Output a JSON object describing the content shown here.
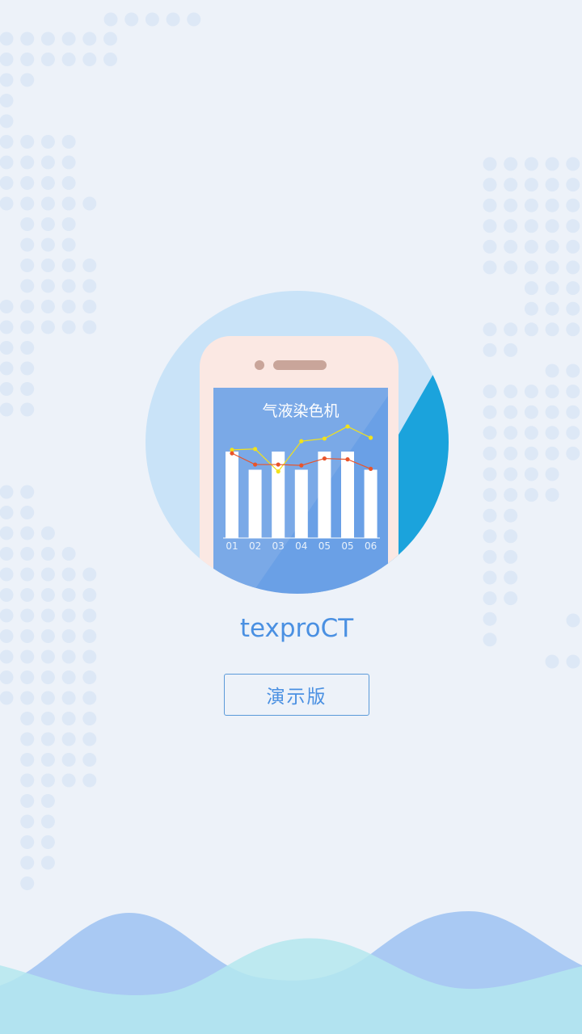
{
  "app": {
    "name": "texproCT",
    "demo_button_label": "演示版"
  },
  "logo": {
    "chart_title": "气液染色机"
  },
  "chart_data": {
    "type": "bar",
    "title": "气液染色机",
    "categories": [
      "01",
      "02",
      "03",
      "04",
      "05",
      "05",
      "06"
    ],
    "bars": [
      1.0,
      0.79,
      1.0,
      0.79,
      1.0,
      1.0,
      0.79
    ],
    "lines": [
      {
        "color": "#f2e21a",
        "values": [
          1.02,
          1.03,
          0.77,
          1.12,
          1.15,
          1.29,
          1.16
        ]
      },
      {
        "color": "#e9542a",
        "values": [
          0.98,
          0.85,
          0.85,
          0.84,
          0.92,
          0.91,
          0.8
        ]
      }
    ],
    "ylim": [
      0,
      1.4
    ]
  },
  "colors": {
    "background": "#edf2f9",
    "accent": "#4a90e2",
    "dot": "#dde8f6",
    "wave_back": "#a6c8f2",
    "wave_front": "#b5e6ef"
  }
}
